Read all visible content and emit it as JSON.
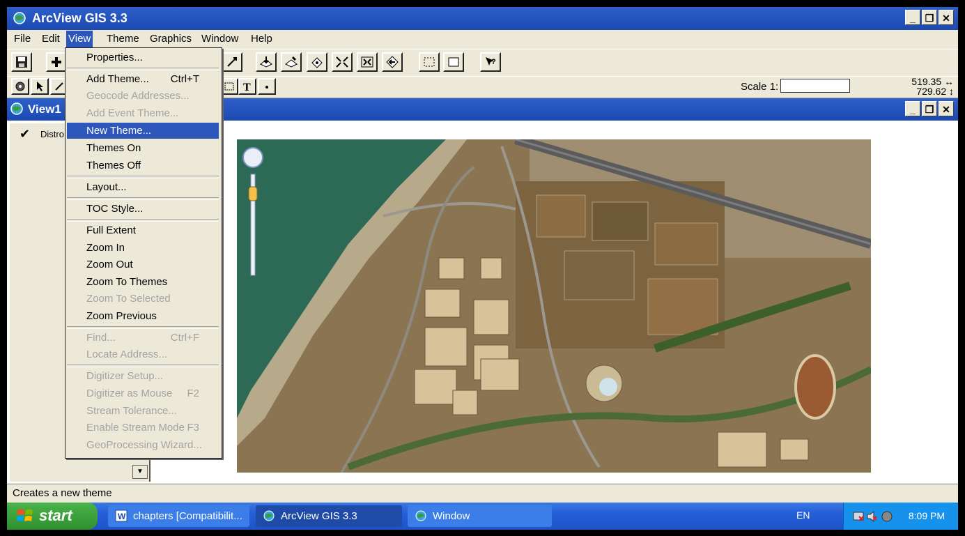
{
  "app": {
    "title": "ArcView GIS 3.3"
  },
  "menubar": {
    "items": [
      "File",
      "Edit",
      "View",
      "Theme",
      "Graphics",
      "Window",
      "Help"
    ],
    "active": "View"
  },
  "toolbar": {
    "scale_label": "Scale 1:",
    "scale_value": "",
    "coord_x": "519.35",
    "coord_y": "729.62"
  },
  "view_window": {
    "title": "View1",
    "toc_entry": "Distro",
    "toc_checked": true
  },
  "view_menu": {
    "items": [
      {
        "label": "Properties...",
        "shortcut": "",
        "enabled": true
      },
      {
        "label": "Add Theme...",
        "shortcut": "Ctrl+T",
        "enabled": true
      },
      {
        "label": "Geocode Addresses...",
        "shortcut": "",
        "enabled": false
      },
      {
        "label": "Add Event Theme...",
        "shortcut": "",
        "enabled": false
      },
      {
        "label": "New Theme...",
        "shortcut": "",
        "enabled": true,
        "highlighted": true
      },
      {
        "label": "Themes On",
        "shortcut": "",
        "enabled": true
      },
      {
        "label": "Themes Off",
        "shortcut": "",
        "enabled": true
      },
      {
        "label": "Layout...",
        "shortcut": "",
        "enabled": true
      },
      {
        "label": "TOC Style...",
        "shortcut": "",
        "enabled": true
      },
      {
        "label": "Full Extent",
        "shortcut": "",
        "enabled": true
      },
      {
        "label": "Zoom In",
        "shortcut": "",
        "enabled": true
      },
      {
        "label": "Zoom Out",
        "shortcut": "",
        "enabled": true
      },
      {
        "label": "Zoom To Themes",
        "shortcut": "",
        "enabled": true
      },
      {
        "label": "Zoom To Selected",
        "shortcut": "",
        "enabled": false
      },
      {
        "label": "Zoom Previous",
        "shortcut": "",
        "enabled": true
      },
      {
        "label": "Find...",
        "shortcut": "Ctrl+F",
        "enabled": false
      },
      {
        "label": "Locate Address...",
        "shortcut": "",
        "enabled": false
      },
      {
        "label": "Digitizer Setup...",
        "shortcut": "",
        "enabled": false
      },
      {
        "label": "Digitizer as Mouse",
        "shortcut": "F2",
        "enabled": false
      },
      {
        "label": "Stream Tolerance...",
        "shortcut": "",
        "enabled": false
      },
      {
        "label": "Enable Stream Mode",
        "shortcut": "F3",
        "enabled": false
      },
      {
        "label": "GeoProcessing Wizard...",
        "shortcut": "",
        "enabled": false
      }
    ]
  },
  "status": {
    "text": "Creates a new theme"
  },
  "taskbar": {
    "start_label": "start",
    "tasks": [
      "chapters [Compatibilit...",
      "ArcView GIS 3.3",
      "Window"
    ],
    "language": "EN",
    "clock": "8:09 PM"
  },
  "colors": {
    "titlebar": "#1c49b2",
    "highlight": "#2d57bb",
    "taskbar": "#245ed7",
    "start": "#3a9a3a"
  }
}
